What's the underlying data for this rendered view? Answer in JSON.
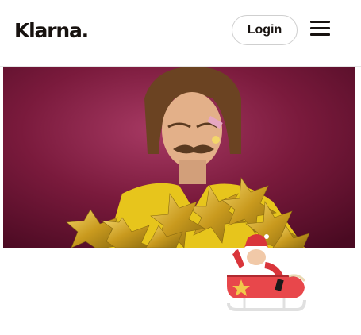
{
  "header": {
    "logo_text": "Klarna.",
    "login_label": "Login",
    "menu_icon": "hamburger-menu-icon"
  },
  "hero": {
    "image": "man-in-gold-star-costume-photo",
    "background_color": "#7a1a3c"
  },
  "decoration": {
    "image": "santa-sleigh-illustration",
    "sleigh_color": "#e8474b"
  }
}
